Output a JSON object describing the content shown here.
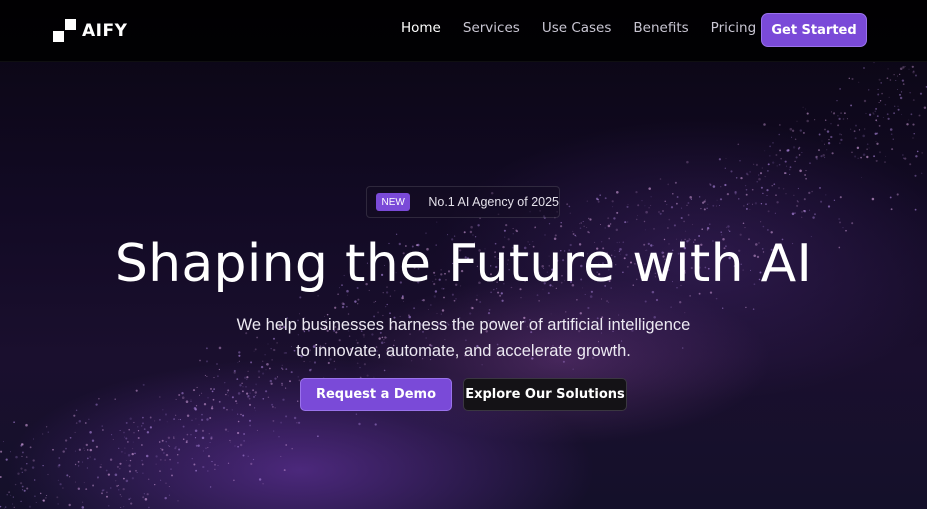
{
  "brand": {
    "name": "AIFY",
    "logo_icon": "checker-squares-icon"
  },
  "nav": {
    "links": [
      {
        "label": "Home",
        "active": true
      },
      {
        "label": "Services",
        "active": false
      },
      {
        "label": "Use Cases",
        "active": false
      },
      {
        "label": "Benefits",
        "active": false
      },
      {
        "label": "Pricing",
        "active": false
      }
    ],
    "cta_label": "Get Started"
  },
  "hero": {
    "badge_tag": "NEW",
    "badge_text": "No.1 AI Agency of 2025",
    "title": "Shaping the Future with AI",
    "subtitle_line1": "We help businesses harness the power of artificial intelligence",
    "subtitle_line2": "to innovate, automate, and accelerate growth.",
    "primary_button": "Request a Demo",
    "secondary_button": "Explore Our Solutions"
  },
  "colors": {
    "accent": "#7a4ad8",
    "background": "#07050d",
    "dark_button": "#141216"
  }
}
